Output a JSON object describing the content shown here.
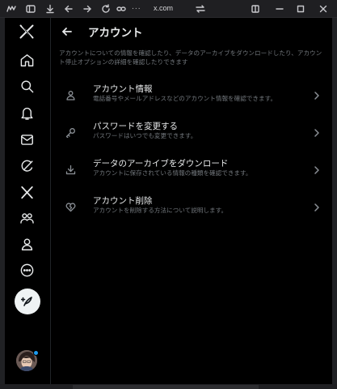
{
  "browser": {
    "url": "x.com",
    "more_dots": "..."
  },
  "nav": {
    "items": [
      "x-logo",
      "home",
      "explore",
      "notifications",
      "messages",
      "grok",
      "premium",
      "communities",
      "profile",
      "more"
    ]
  },
  "header": {
    "title": "アカウント"
  },
  "description": "アカウントについての情報を確認したり、データのアーカイブをダウンロードしたり、アカウント停止オプションの詳細を確認したりできます",
  "items": [
    {
      "label": "アカウント情報",
      "desc": "電話番号やメールアドレスなどのアカウント情報を確認できます。",
      "icon": "person-icon"
    },
    {
      "label": "パスワードを変更する",
      "desc": "パスワードはいつでも変更できます。",
      "icon": "key-icon"
    },
    {
      "label": "データのアーカイブをダウンロード",
      "desc": "アカウントに保存されている情報の種類を確認できます。",
      "icon": "download-icon"
    },
    {
      "label": "アカウント削除",
      "desc": "アカウントを削除する方法について説明します。",
      "icon": "broken-heart-icon"
    }
  ],
  "colors": {
    "background": "#000000",
    "text_primary": "#e7e9ea",
    "text_secondary": "#71767b",
    "accent": "#1d9bf0"
  }
}
